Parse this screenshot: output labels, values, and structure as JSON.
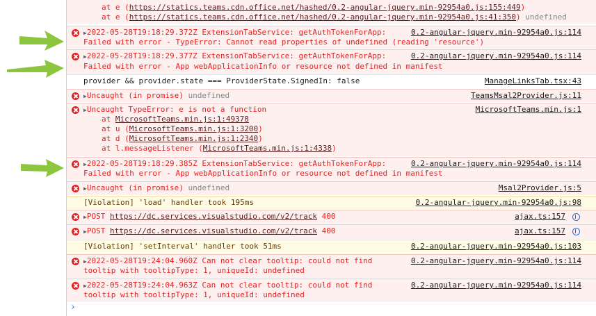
{
  "top_stack": {
    "line1_prefix": "at e (",
    "line1_link": "https://statics.teams.cdn.office.net/hashed/0.2-angular-jquery.min-92954a0.js:155:449",
    "line1_suffix": ")",
    "line2_prefix": "at e (",
    "line2_link": "https://statics.teams.cdn.office.net/hashed/0.2-angular-jquery.min-92954a0.js:41:350",
    "line2_suffix": ")",
    "line2_undefined": "undefined"
  },
  "entries": [
    {
      "line1": "2022-05-28T19:18:29.372Z ExtensionTabService: getAuthTokenForApp:",
      "line2": "Failed with error - TypeError: Cannot read properties of undefined (reading 'resource')",
      "source": "0.2-angular-jquery.min-92954a0.js:114"
    },
    {
      "line1": "2022-05-28T19:18:29.377Z ExtensionTabService: getAuthTokenForApp:",
      "line2": "Failed with error - App webApplicationInfo or resource not defined in manifest",
      "source": "0.2-angular-jquery.min-92954a0.js:114"
    },
    {
      "line1": "provider && provider.state === ProviderState.SignedIn: false",
      "source": "ManageLinksTab.tsx:43"
    },
    {
      "line1": "Uncaught (in promise)",
      "undef": "undefined",
      "source": "TeamsMsal2Provider.js:11"
    },
    {
      "line1": "Uncaught TypeError: e is not a function",
      "source": "MicrosoftTeams.min.js:1",
      "stack": [
        {
          "prefix": "at ",
          "link": "MicrosoftTeams.min.js:1:49378",
          "suffix": ""
        },
        {
          "prefix": "at u (",
          "link": "MicrosoftTeams.min.js:1:3200",
          "suffix": ")"
        },
        {
          "prefix": "at d (",
          "link": "MicrosoftTeams.min.js:1:2340",
          "suffix": ")"
        },
        {
          "prefix": "at l.messageListener (",
          "link": "MicrosoftTeams.min.js:1:4338",
          "suffix": ")"
        }
      ]
    },
    {
      "line1": "2022-05-28T19:18:29.385Z ExtensionTabService: getAuthTokenForApp:",
      "line2": "Failed with error - App webApplicationInfo or resource not defined in manifest",
      "source": "0.2-angular-jquery.min-92954a0.js:114"
    },
    {
      "line1": "Uncaught (in promise)",
      "undef": "undefined",
      "source": "Msal2Provider.js:5"
    },
    {
      "line1": "[Violation] 'load' handler took 195ms",
      "source": "0.2-angular-jquery.min-92954a0.js:98"
    },
    {
      "line1_prefix": "POST ",
      "link": "https://dc.services.visualstudio.com/v2/track",
      "status": "400",
      "source": "ajax.ts:157"
    },
    {
      "line1_prefix": "POST ",
      "link": "https://dc.services.visualstudio.com/v2/track",
      "status": "400",
      "source": "ajax.ts:157"
    },
    {
      "line1": "[Violation] 'setInterval' handler took 51ms",
      "source": "0.2-angular-jquery.min-92954a0.js:103"
    },
    {
      "line1": "2022-05-28T19:24:04.960Z Can not clear tooltip: could not find",
      "line2": "tooltip with tooltipType: 1, uniqueId: undefined",
      "source": "0.2-angular-jquery.min-92954a0.js:114"
    },
    {
      "line1": "2022-05-28T19:24:04.963Z Can not clear tooltip: could not find",
      "line2": "tooltip with tooltipType: 1, uniqueId: undefined",
      "source": "0.2-angular-jquery.min-92954a0.js:114"
    }
  ],
  "prompt_symbol": "›",
  "colors": {
    "error_bg": "#fff0f0",
    "error_text": "#e41f1f",
    "warn_bg": "#fffbe5",
    "arrow": "#8cc63f"
  }
}
